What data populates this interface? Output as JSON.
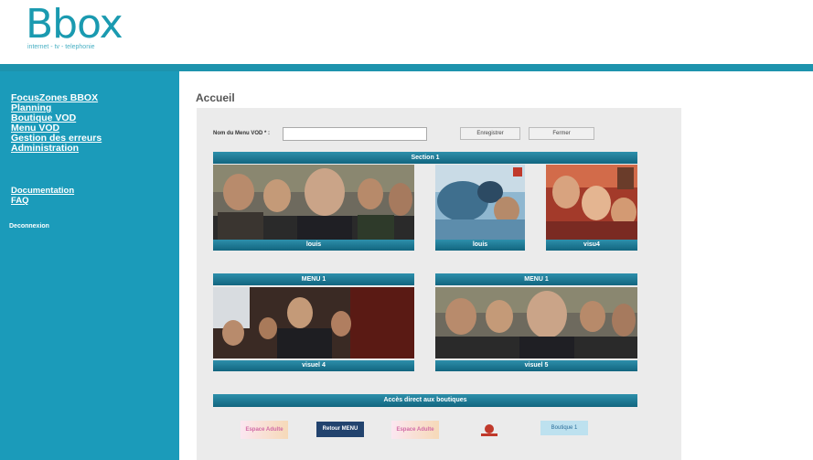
{
  "logo": {
    "brand": "Bbox",
    "tagline": "internet - tv - telephonie"
  },
  "sidebar": {
    "primary": [
      "FocusZones BBOX",
      "Planning",
      "Boutique VOD",
      "Menu VOD",
      "Gestion des erreurs",
      "Administration"
    ],
    "secondary": [
      "Documentation",
      "FAQ"
    ],
    "logout": "Deconnexion"
  },
  "page": {
    "title": "Accueil"
  },
  "form": {
    "label": "Nom du Menu VOD * :",
    "value": "",
    "save_label": "Enregistrer",
    "close_label": "Fermer"
  },
  "section": {
    "title": "Section 1",
    "tiles": [
      {
        "caption": "louis"
      },
      {
        "caption": "louis"
      },
      {
        "caption": "visu4"
      }
    ]
  },
  "menus": [
    {
      "title": "MENU 1",
      "caption": "visuel 4"
    },
    {
      "title": "MENU 1",
      "caption": "visuel 5"
    }
  ],
  "shops": {
    "title": "Accès direct aux boutiques",
    "items": [
      {
        "label": "Espace Adulte",
        "icon": "adult-space-icon"
      },
      {
        "label": "Retour MENU",
        "icon": "return-menu-icon"
      },
      {
        "label": "Espace Adulte",
        "icon": "adult-space-icon-2"
      },
      {
        "label": "",
        "icon": "shop-logo-icon"
      },
      {
        "label": "Boutique 1",
        "icon": "boutique-icon"
      }
    ]
  },
  "colors": {
    "accent": "#1b9bba",
    "bar": "#12657f",
    "panel": "#ebebeb"
  }
}
